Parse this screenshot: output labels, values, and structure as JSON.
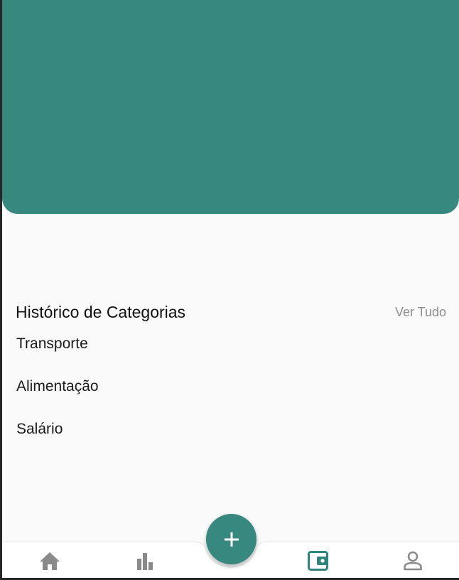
{
  "colors": {
    "primary": "#378980",
    "background": "#fafafa",
    "nav_icon_inactive": "#8a8a8a",
    "nav_icon_active": "#2f857b"
  },
  "section": {
    "title": "Histórico de Categorias",
    "see_all": "Ver Tudo"
  },
  "categories": [
    {
      "label": "Transporte"
    },
    {
      "label": "Alimentação"
    },
    {
      "label": "Salário"
    }
  ],
  "bottom_nav": {
    "items": [
      {
        "icon": "home-icon",
        "active": false
      },
      {
        "icon": "bar-chart-icon",
        "active": false
      },
      {
        "icon": "wallet-icon",
        "active": true
      },
      {
        "icon": "profile-icon",
        "active": false
      }
    ],
    "fab_icon": "plus-icon"
  }
}
